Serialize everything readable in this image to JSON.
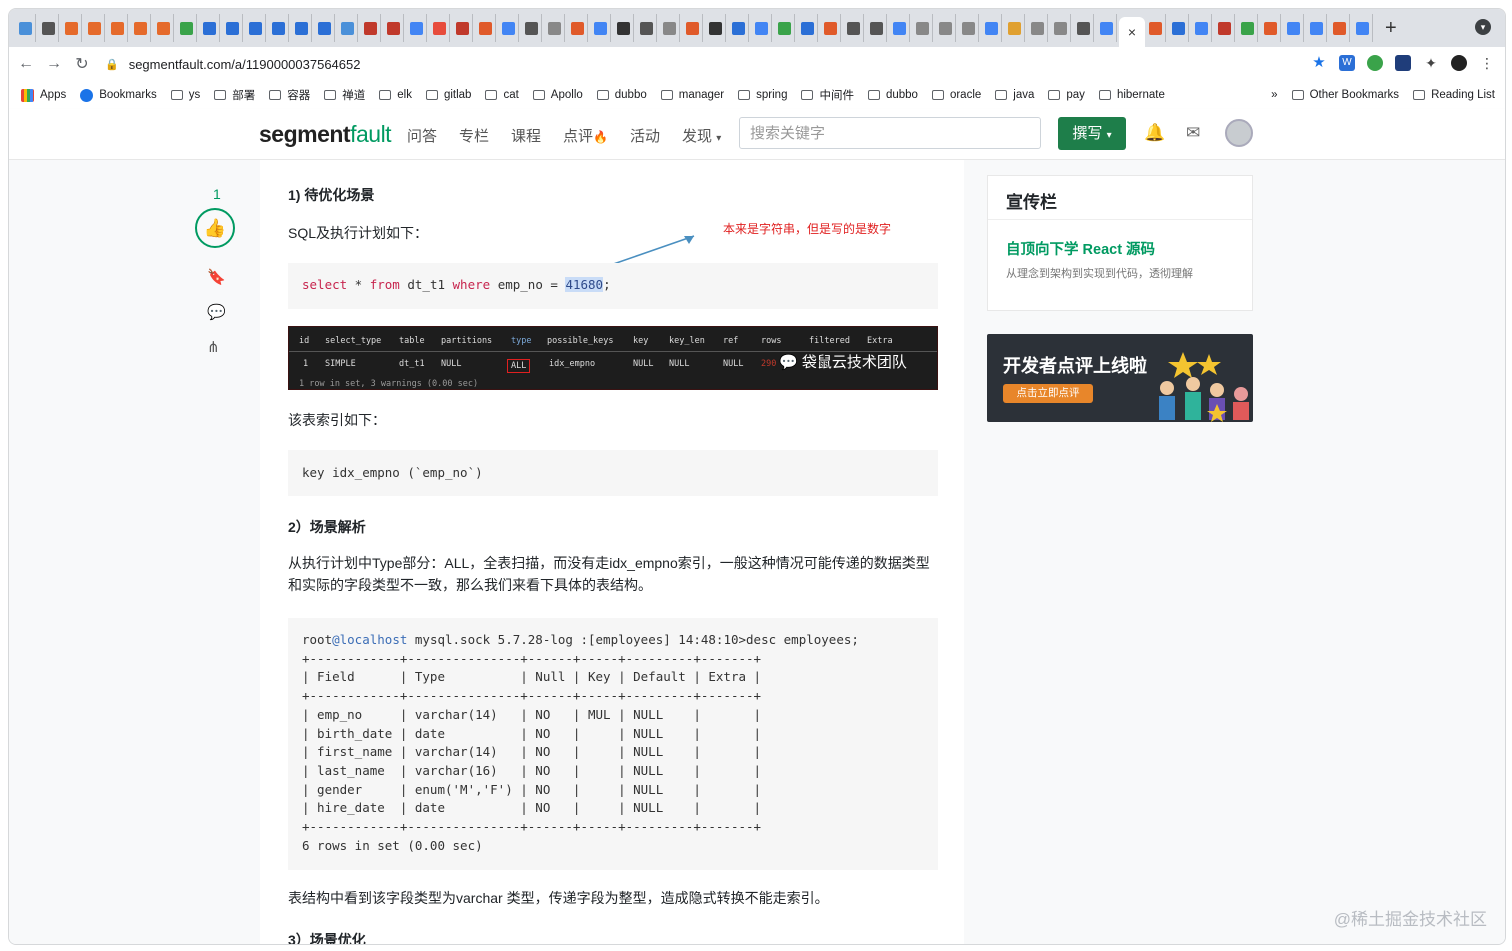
{
  "browser": {
    "url": "segmentfault.com/a/1190000037564652",
    "bookmarks": [
      "Apps",
      "Bookmarks",
      "ys",
      "部署",
      "容器",
      "禅道",
      "elk",
      "gitlab",
      "cat",
      "Apollo",
      "dubbo",
      "manager",
      "spring",
      "中间件",
      "dubbo",
      "oracle",
      "java",
      "pay",
      "hibernate"
    ],
    "other_bookmarks": "Other Bookmarks",
    "reading_list": "Reading List",
    "overflow": "»",
    "close_tab": "×",
    "new_tab": "+"
  },
  "header": {
    "logo_a": "segment",
    "logo_b": "fault",
    "nav": [
      "问答",
      "专栏",
      "课程",
      "点评",
      "活动",
      "发现"
    ],
    "search_placeholder": "搜索关键字",
    "write_label": "撰写"
  },
  "article": {
    "vote_count": "1",
    "h_scene": "1) 待优化场景",
    "sql_intro": "SQL及执行计划如下：",
    "annotation": "本来是字符串，但是写的是数字",
    "sql_kw_select": "select",
    "sql_star": " * ",
    "sql_kw_from": "from",
    "sql_table": " dt_t1 ",
    "sql_kw_where": "where",
    "sql_cond": " emp_no = ",
    "sql_value": "41680",
    "sql_end": ";",
    "plan": {
      "headers": [
        "id",
        "select_type",
        "table",
        "partitions",
        "type",
        "possible_keys",
        "key",
        "key_len",
        "ref",
        "rows",
        "filtered",
        "Extra"
      ],
      "row": [
        "1",
        "SIMPLE",
        "dt_t1",
        "NULL",
        "ALL",
        "idx_empno",
        "NULL",
        "NULL",
        "NULL",
        "290"
      ],
      "footer": "1 row in set, 3 warnings (0.00 sec)",
      "watermark": "袋鼠云技术团队"
    },
    "index_intro": "该表索引如下：",
    "index_code": "key idx_empno (`emp_no`)",
    "h_analysis": "2）场景解析",
    "analysis_text": "从执行计划中Type部分：ALL，全表扫描，而没有走idx_empno索引，一般这种情况可能传递的数据类型和实际的字段类型不一致，那么我们来看下具体的表结构。",
    "desc_prompt_user": "root",
    "desc_prompt_host": "@localhost",
    "desc_prompt_rest": " mysql.sock 5.7.28-log :[employees] 14:48:10>desc employees;",
    "desc_table": "+------------+---------------+------+-----+---------+-------+\n| Field      | Type          | Null | Key | Default | Extra |\n+------------+---------------+------+-----+---------+-------+\n| emp_no     | varchar(14)   | NO   | MUL | NULL    |       |\n| birth_date | date          | NO   |     | NULL    |       |\n| first_name | varchar(14)   | NO   |     | NULL    |       |\n| last_name  | varchar(16)   | NO   |     | NULL    |       |\n| gender     | enum('M','F') | NO   |     | NULL    |       |\n| hire_date  | date          | NO   |     | NULL    |       |\n+------------+---------------+------+-----+---------+-------+\n6 rows in set (0.00 sec)",
    "conclusion": "表结构中看到该字段类型为varchar 类型，传递字段为整型，造成隐式转换不能走索引。",
    "h_optimize": "3）场景优化"
  },
  "sidebar": {
    "promo_title": "宣传栏",
    "promo_link": "自顶向下学 React 源码",
    "promo_sub": "从理念到架构到实现到代码，透彻理解",
    "banner_title": "开发者点评上线啦",
    "banner_btn": "点击立即点评"
  },
  "watermark": "@稀土掘金技术社区"
}
